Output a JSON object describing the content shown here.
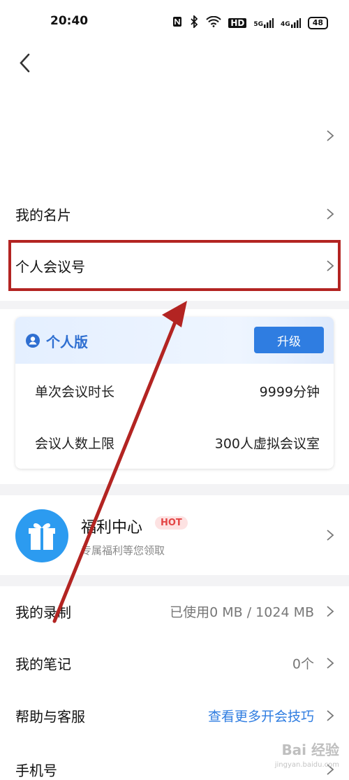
{
  "status": {
    "time": "20:40",
    "icons": [
      "nfc-icon",
      "bluetooth-icon",
      "wifi-icon",
      "hd-icon",
      "signal-5g-icon",
      "signal-4g-icon"
    ],
    "network_5g": "5G",
    "network_4g": "4G",
    "hd": "HD",
    "battery": "48"
  },
  "menu": {
    "card": "我的名片",
    "meeting_id": "个人会议号"
  },
  "plan": {
    "name": "个人版",
    "upgrade": "升级",
    "rows": [
      {
        "key": "单次会议时长",
        "value": "9999分钟"
      },
      {
        "key": "会议人数上限",
        "value": "300人虚拟会议室"
      }
    ]
  },
  "welfare": {
    "title": "福利中心",
    "badge": "HOT",
    "subtitle": "专属福利等您领取"
  },
  "list": [
    {
      "label": "我的录制",
      "value": "已使用0 MB / 1024 MB"
    },
    {
      "label": "我的笔记",
      "value": "0个"
    },
    {
      "label": "帮助与客服",
      "value": "查看更多开会技巧"
    },
    {
      "label": "手机号",
      "value": ""
    }
  ],
  "watermark": {
    "brand": "Bai 经验",
    "url": "jingyan.baidu.com"
  },
  "colors": {
    "accent": "#2f7de1",
    "highlight": "#b32422",
    "hot": "#e34545"
  }
}
